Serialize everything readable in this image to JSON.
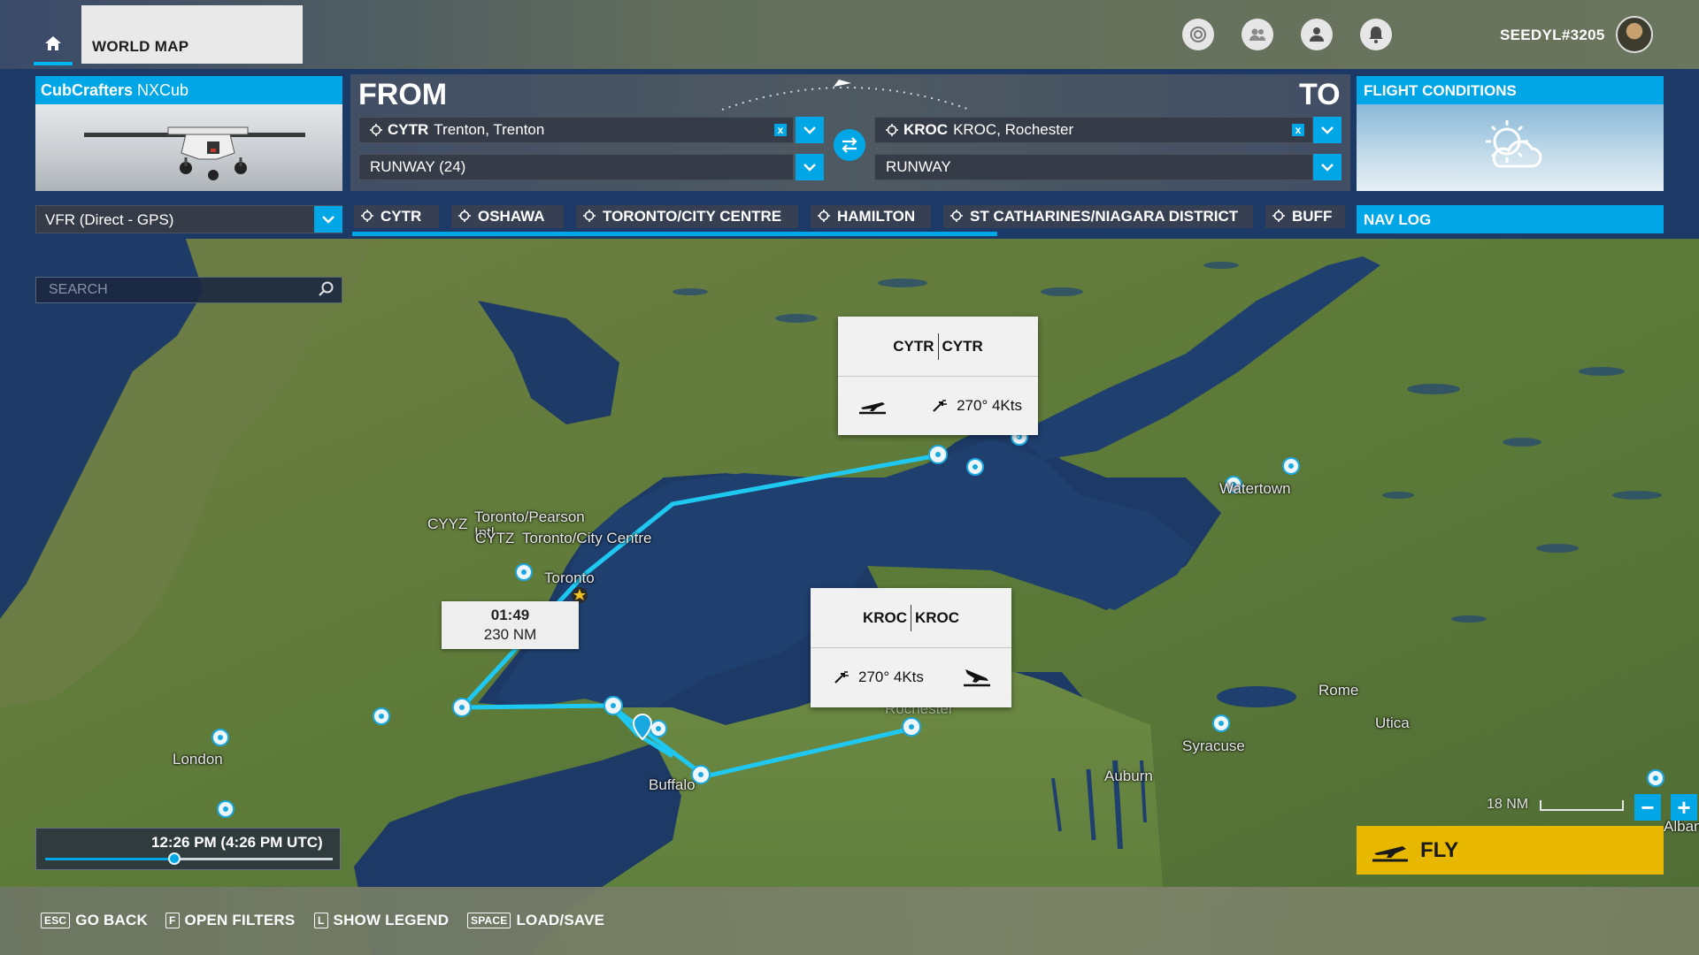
{
  "topbar": {
    "tab_title": "WORLD MAP",
    "username": "SEEDYL#3205",
    "icons": [
      "home-icon",
      "live-icon",
      "friends-icon",
      "profile-icon",
      "notifications-icon"
    ]
  },
  "aircraft": {
    "brand": "CubCrafters",
    "model": "NXCub"
  },
  "route": {
    "from_label": "FROM",
    "to_label": "TO",
    "departure": {
      "code": "CYTR",
      "name": "Trenton, Trenton",
      "runway": "RUNWAY (24)"
    },
    "arrival": {
      "code": "KROC",
      "name": "KROC, Rochester",
      "runway": "RUNWAY"
    },
    "clear_symbol": "x"
  },
  "conditions": {
    "title": "FLIGHT CONDITIONS"
  },
  "flight_plan": {
    "selected": "VFR (Direct - GPS)"
  },
  "waypoints": [
    "CYTR",
    "OSHAWA",
    "TORONTO/CITY CENTRE",
    "HAMILTON",
    "ST CATHARINES/NIAGARA DISTRICT",
    "BUFF"
  ],
  "waypoint_progress_fraction": 0.65,
  "navlog": {
    "title": "NAV LOG"
  },
  "search": {
    "placeholder": "SEARCH"
  },
  "map_labels": {
    "cyyz": "CYYZ",
    "pearson": "Toronto/Pearson",
    "intl": "Intl",
    "cytz": "CYTZ",
    "city_centre": "Toronto/City Centre",
    "toronto": "Toronto",
    "london": "London",
    "buffalo": "Buffalo",
    "rochester": "Rochester",
    "watertown": "Watertown",
    "syracuse": "Syracuse",
    "rome": "Rome",
    "utica": "Utica",
    "auburn": "Auburn",
    "albany": "Alban"
  },
  "popups": {
    "departure": {
      "code1": "CYTR",
      "code2": "CYTR",
      "wind": "270° 4Kts"
    },
    "arrival": {
      "code1": "KROC",
      "code2": "KROC",
      "wind": "270° 4Kts"
    }
  },
  "leg": {
    "time": "01:49",
    "distance": "230 NM"
  },
  "time_slider": {
    "label": "12:26 PM (4:26 PM UTC)",
    "position_fraction": 0.45
  },
  "scale": {
    "label": "18 NM"
  },
  "zoom": {
    "minus": "−",
    "plus": "+"
  },
  "fly": {
    "label": "FLY"
  },
  "hints": [
    {
      "key": "ESC",
      "label": "GO BACK"
    },
    {
      "key": "F",
      "label": "OPEN FILTERS"
    },
    {
      "key": "L",
      "label": "SHOW LEGEND"
    },
    {
      "key": "SPACE",
      "label": "LOAD/SAVE"
    }
  ],
  "colors": {
    "accent": "#00a6e6",
    "route": "#1ec8f0",
    "fly": "#e8b800",
    "water": "#1d3a66",
    "land": "#5f7a3a"
  }
}
